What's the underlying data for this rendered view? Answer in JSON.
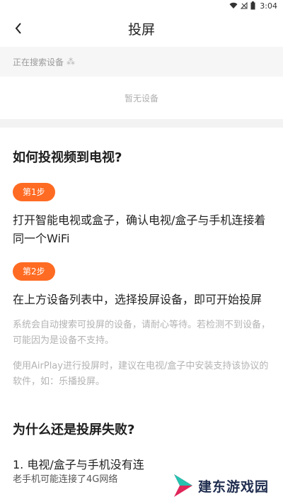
{
  "status_bar": {
    "time": "3:04"
  },
  "header": {
    "title": "投屏"
  },
  "search": {
    "status_text": "正在搜索设备",
    "spinner_glyph": "⁂"
  },
  "device_list": {
    "empty_text": "暂无设备"
  },
  "howto": {
    "title": "如何投视频到电视?",
    "steps": [
      {
        "badge": "第1步",
        "text": "打开智能电视或盒子，确认电视/盒子与手机连接着同一个WiFi"
      },
      {
        "badge": "第2步",
        "text": "在上方设备列表中，选择投屏设备，即可开始投屏"
      }
    ],
    "tips": [
      "系统会自动搜索可投屏的设备，请耐心等待。若检测不到设备，可能因为是设备不支持。",
      "使用AirPlay进行投屏时，建议在电视/盒子中安装支持该协议的软件，如：乐播投屏。"
    ]
  },
  "failure": {
    "title": "为什么还是投屏失败?",
    "items": [
      "1. 电视/盒子与手机没有连",
      "老手机可能连接了4G网络"
    ]
  },
  "watermark": {
    "text": "建东游戏园"
  },
  "colors": {
    "accent": "#ff6b22",
    "tip_text": "#b3b3b3",
    "search_bg": "#f6f6f6"
  },
  "icons": {
    "back": "chevron-left-icon",
    "wifi": "wifi-icon",
    "battery": "battery-icon"
  }
}
